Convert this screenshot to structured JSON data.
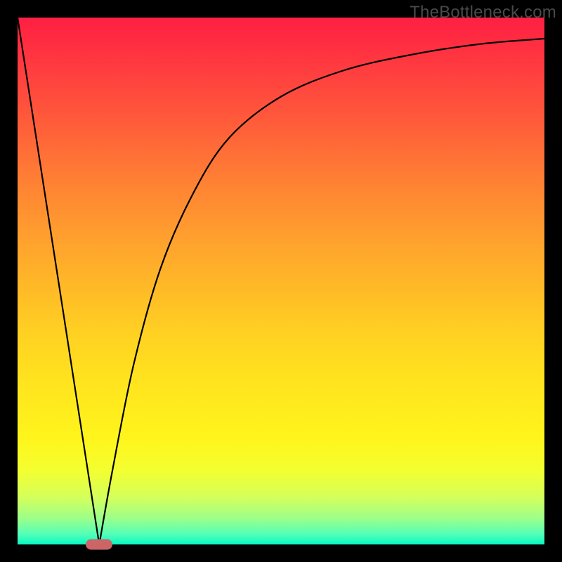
{
  "watermark": "TheBottleneck.com",
  "colors": {
    "frame": "#000000",
    "curve": "#000000",
    "marker": "#cc6666"
  },
  "chart_data": {
    "type": "line",
    "title": "",
    "xlabel": "",
    "ylabel": "",
    "xlim": [
      0,
      100
    ],
    "ylim": [
      0,
      100
    ],
    "grid": false,
    "legend": false,
    "annotations": [
      {
        "kind": "marker",
        "x": 15.5,
        "y": 0,
        "shape": "pill",
        "color": "#cc6666"
      }
    ],
    "series": [
      {
        "name": "left-branch",
        "x": [
          0,
          7.75,
          15.5
        ],
        "values": [
          100,
          50,
          0
        ]
      },
      {
        "name": "right-branch",
        "x": [
          15.5,
          18,
          22,
          27,
          33,
          40,
          50,
          62,
          75,
          88,
          100
        ],
        "values": [
          0,
          14,
          34,
          52,
          66,
          77,
          85,
          90,
          93,
          95,
          96
        ]
      }
    ],
    "background_gradient": {
      "direction": "vertical",
      "stops": [
        {
          "pct": 0,
          "hex": "#ff1f42"
        },
        {
          "pct": 10,
          "hex": "#ff3d40"
        },
        {
          "pct": 20,
          "hex": "#ff5c3a"
        },
        {
          "pct": 30,
          "hex": "#ff7d34"
        },
        {
          "pct": 40,
          "hex": "#ff9b2f"
        },
        {
          "pct": 50,
          "hex": "#ffb628"
        },
        {
          "pct": 60,
          "hex": "#ffd122"
        },
        {
          "pct": 70,
          "hex": "#ffe51e"
        },
        {
          "pct": 80,
          "hex": "#fff51c"
        },
        {
          "pct": 86,
          "hex": "#f3ff30"
        },
        {
          "pct": 91,
          "hex": "#d5ff5a"
        },
        {
          "pct": 95,
          "hex": "#9dff89"
        },
        {
          "pct": 98,
          "hex": "#55ffb7"
        },
        {
          "pct": 100,
          "hex": "#08f7c4"
        }
      ]
    }
  }
}
